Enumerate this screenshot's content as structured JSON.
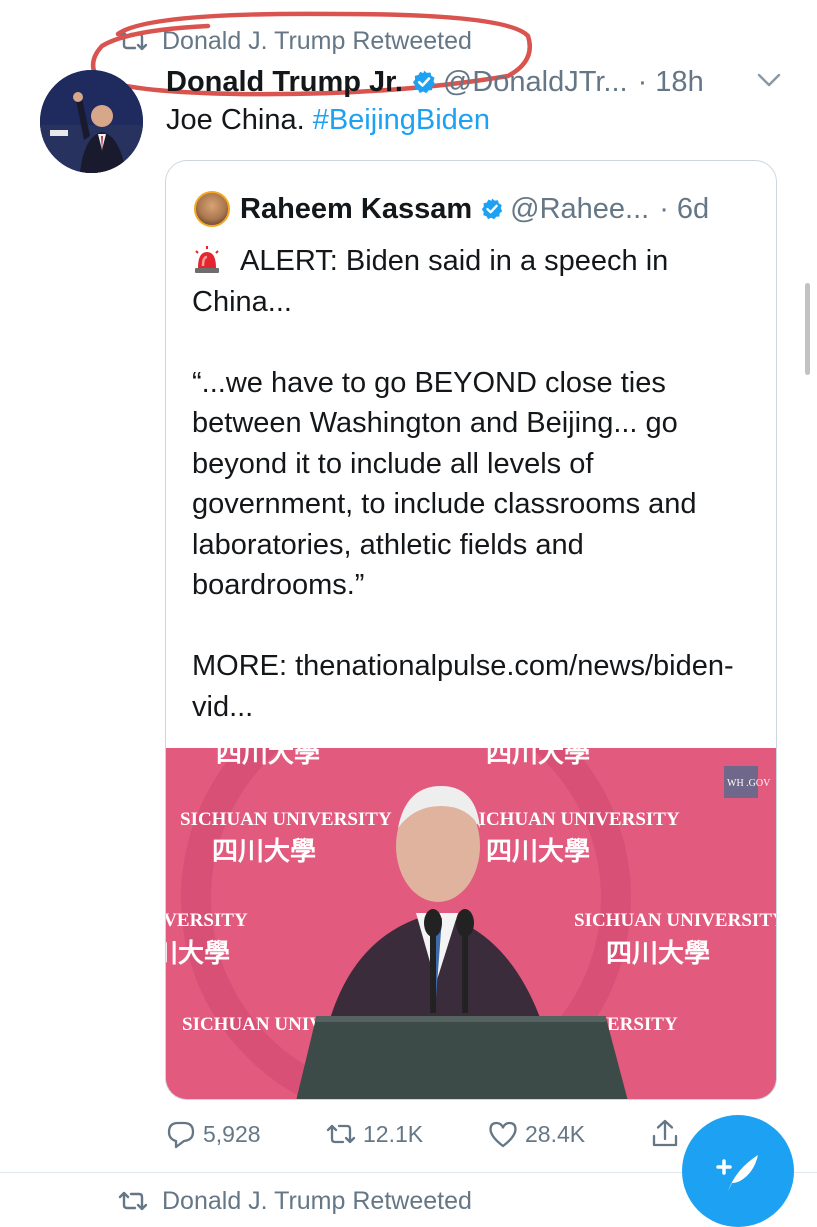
{
  "retweet_context": {
    "label": "Donald J. Trump Retweeted"
  },
  "tweet": {
    "author_name": "Donald Trump Jr.",
    "handle": "@DonaldJTr...",
    "time": "· 18h",
    "text_plain": "Joe China. ",
    "hashtag": "#BeijingBiden"
  },
  "quoted_tweet": {
    "author_name": "Raheem Kassam",
    "handle": "@Rahee...",
    "time": "· 6d",
    "alert_line": "ALERT: Biden said in a speech in China...",
    "quote": "“...we have to go BEYOND close ties between Washington and Beijing... go beyond it to include all levels of government, to include classrooms and laboratories, athletic fields and boardrooms.”",
    "more": "MORE: thenationalpulse.com/news/biden-vid...",
    "media": {
      "banner_text": "SICHUAN UNIVERSITY",
      "chinese_text": "四川大學",
      "watermark": "WH .GOV"
    }
  },
  "actions": {
    "replies": "5,928",
    "retweets": "12.1K",
    "likes": "28.4K"
  },
  "next_retweet_context": {
    "label": "Donald J. Trump Retweeted"
  },
  "colors": {
    "accent": "#1da1f2",
    "muted": "#657786",
    "highlight": "#d9534f"
  },
  "icons": [
    "retweet-icon",
    "verified-badge-icon",
    "chevron-down-icon",
    "reply-icon",
    "like-icon",
    "share-icon",
    "compose-tweet-icon",
    "siren-emoji-icon"
  ]
}
